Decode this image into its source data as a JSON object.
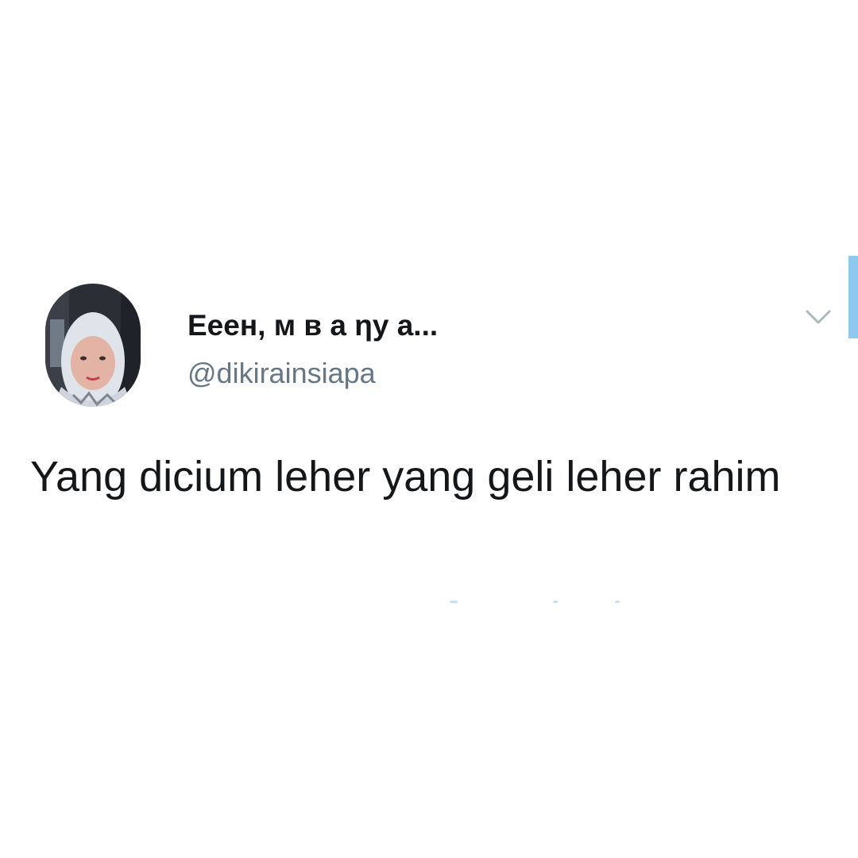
{
  "tweet": {
    "display_name": "Еeeн, м в а ηу а...",
    "handle": "@dikirainsiapa",
    "text": "Yang dicium leher yang geli leher rahim",
    "avatar_icon": "profile-photo",
    "menu_icon": "chevron-down-icon"
  },
  "colors": {
    "background": "#ffffff",
    "text": "#14171a",
    "secondary_text": "#657786",
    "accent": "#8ec8ef"
  }
}
